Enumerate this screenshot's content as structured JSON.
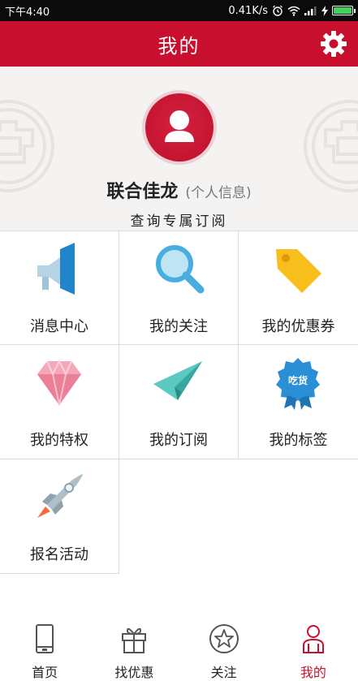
{
  "status_bar": {
    "time": "下午4:40",
    "network_speed": "0.41K/s",
    "alarm_icon": "alarm-clock-icon",
    "wifi_icon": "wifi-icon",
    "signal_icon": "cellular-signal-icon",
    "battery_icon": "battery-charging-icon",
    "battery_color": "#3fd35a"
  },
  "header": {
    "title": "我的",
    "settings_icon": "gear-icon",
    "color": "#c8102e"
  },
  "profile": {
    "avatar_icon": "user-avatar-icon",
    "name": "联合佳龙",
    "info_link": "(个人信息)",
    "subscribe_link": "查询专属订阅"
  },
  "menu": [
    {
      "label": "消息中心",
      "icon": "megaphone-icon"
    },
    {
      "label": "我的关注",
      "icon": "magnifier-icon"
    },
    {
      "label": "我的优惠券",
      "icon": "price-tag-icon"
    },
    {
      "label": "我的特权",
      "icon": "diamond-icon"
    },
    {
      "label": "我的订阅",
      "icon": "paper-plane-icon"
    },
    {
      "label": "我的标签",
      "icon": "badge-icon",
      "badge_text": "吃货"
    },
    {
      "label": "报名活动",
      "icon": "rocket-icon"
    }
  ],
  "bottom_nav": [
    {
      "label": "首页",
      "icon": "phone-icon",
      "active": false
    },
    {
      "label": "找优惠",
      "icon": "gift-box-icon",
      "active": false
    },
    {
      "label": "关注",
      "icon": "star-circle-icon",
      "active": false
    },
    {
      "label": "我的",
      "icon": "person-icon",
      "active": true
    }
  ]
}
